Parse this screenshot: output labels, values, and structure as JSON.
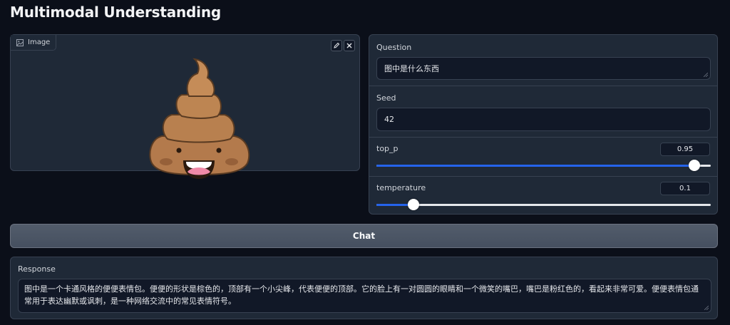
{
  "page": {
    "title": "Multimodal Understanding"
  },
  "image_panel": {
    "label": "Image",
    "icon": "image-icon",
    "edit_icon": "pencil-icon",
    "close_icon": "close-icon",
    "content": "poop-emoji-image"
  },
  "question": {
    "label": "Question",
    "value": "图中是什么东西"
  },
  "seed": {
    "label": "Seed",
    "value": "42"
  },
  "top_p": {
    "label": "top_p",
    "value": "0.95",
    "fraction": 0.95
  },
  "temperature": {
    "label": "temperature",
    "value": "0.1",
    "fraction": 0.11
  },
  "chat_button": {
    "label": "Chat"
  },
  "response": {
    "label": "Response",
    "value": "图中是一个卡通风格的便便表情包。便便的形状是棕色的，顶部有一个小尖峰，代表便便的顶部。它的脸上有一对圆圆的眼睛和一个微笑的嘴巴，嘴巴是粉红色的，看起来非常可爱。便便表情包通常用于表达幽默或讽刺，是一种网络交流中的常见表情符号。"
  },
  "colors": {
    "background": "#0b0f19",
    "panel": "#1f2937",
    "accent": "#2563eb",
    "poop_brown": "#b0784a",
    "mouth_pink": "#f08aa8"
  }
}
